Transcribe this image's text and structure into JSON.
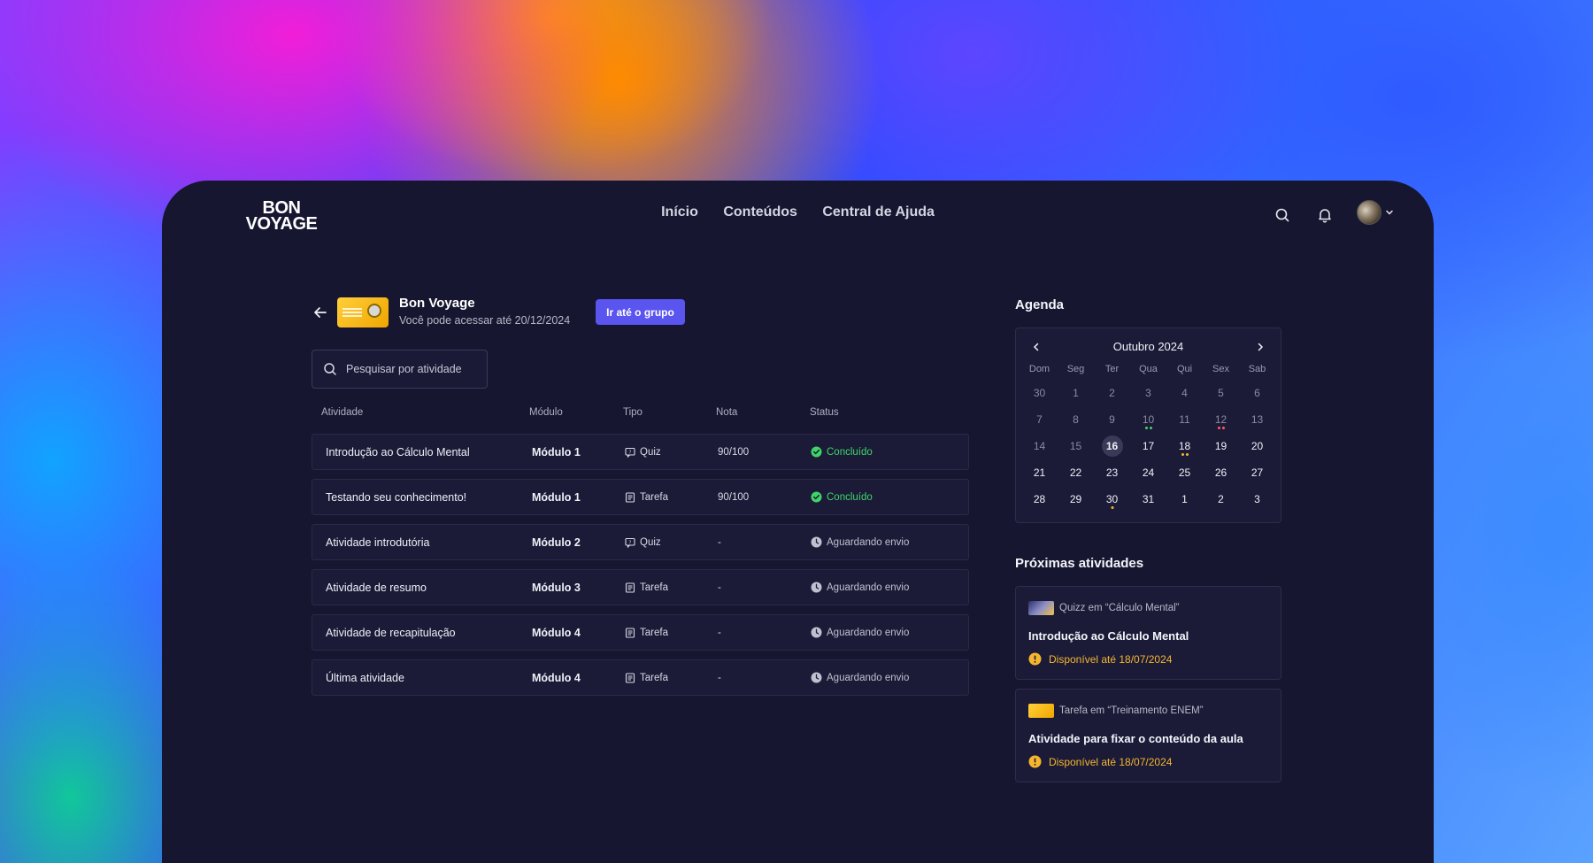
{
  "brand": {
    "logo_line1": "BON",
    "logo_line2": "VOYAGE"
  },
  "nav": {
    "items": [
      "Início",
      "Conteúdos",
      "Central de Ajuda"
    ]
  },
  "course": {
    "title": "Bon Voyage",
    "access": "Você pode acessar até 20/12/2024",
    "group_button": "Ir até o grupo"
  },
  "search": {
    "placeholder": "Pesquisar por atividade"
  },
  "table": {
    "headers": [
      "Atividade",
      "Módulo",
      "Tipo",
      "Nota",
      "Status"
    ],
    "rows": [
      {
        "activity": "Introdução ao Cálculo Mental",
        "module": "Módulo 1",
        "type": "Quiz",
        "type_icon": "quiz-icon",
        "grade": "90/100",
        "status": "Concluído",
        "status_kind": "done"
      },
      {
        "activity": "Testando seu conhecimento!",
        "module": "Módulo 1",
        "type": "Tarefa",
        "type_icon": "task-icon",
        "grade": "90/100",
        "status": "Concluído",
        "status_kind": "done"
      },
      {
        "activity": "Atividade introdutória",
        "module": "Módulo 2",
        "type": "Quiz",
        "type_icon": "quiz-icon",
        "grade": "-",
        "status": "Aguardando envio",
        "status_kind": "waiting"
      },
      {
        "activity": "Atividade de resumo",
        "module": "Módulo 3",
        "type": "Tarefa",
        "type_icon": "task-icon",
        "grade": "-",
        "status": "Aguardando envio",
        "status_kind": "waiting"
      },
      {
        "activity": "Atividade de recapitulação",
        "module": "Módulo 4",
        "type": "Tarefa",
        "type_icon": "task-icon",
        "grade": "-",
        "status": "Aguardando envio",
        "status_kind": "waiting"
      },
      {
        "activity": "Última atividade",
        "module": "Módulo 4",
        "type": "Tarefa",
        "type_icon": "task-icon",
        "grade": "-",
        "status": "Aguardando envio",
        "status_kind": "waiting"
      }
    ]
  },
  "agenda": {
    "title": "Agenda",
    "month": "Outubro 2024",
    "weekdays": [
      "Dom",
      "Seg",
      "Ter",
      "Qua",
      "Qui",
      "Sex",
      "Sab"
    ],
    "days": [
      {
        "d": "30",
        "m": true
      },
      {
        "d": "1",
        "m": true
      },
      {
        "d": "2",
        "m": true
      },
      {
        "d": "3",
        "m": true
      },
      {
        "d": "4",
        "m": true
      },
      {
        "d": "5",
        "m": true
      },
      {
        "d": "6",
        "m": true
      },
      {
        "d": "7",
        "m": true
      },
      {
        "d": "8",
        "m": true
      },
      {
        "d": "9",
        "m": true
      },
      {
        "d": "10",
        "m": true,
        "dots": [
          "#3fd468",
          "#3fd468"
        ]
      },
      {
        "d": "11",
        "m": true
      },
      {
        "d": "12",
        "m": true,
        "dots": [
          "#ff5a5a",
          "#ff5a5a"
        ]
      },
      {
        "d": "13",
        "m": true
      },
      {
        "d": "14",
        "m": true
      },
      {
        "d": "15",
        "m": true
      },
      {
        "d": "16",
        "today": true
      },
      {
        "d": "17"
      },
      {
        "d": "18",
        "dots": [
          "#f5b52e",
          "#f5b52e"
        ]
      },
      {
        "d": "19"
      },
      {
        "d": "20"
      },
      {
        "d": "21"
      },
      {
        "d": "22"
      },
      {
        "d": "23"
      },
      {
        "d": "24"
      },
      {
        "d": "25"
      },
      {
        "d": "26"
      },
      {
        "d": "27"
      },
      {
        "d": "28"
      },
      {
        "d": "29"
      },
      {
        "d": "30",
        "dots": [
          "#f5b52e"
        ]
      },
      {
        "d": "31"
      },
      {
        "d": "1"
      },
      {
        "d": "2"
      },
      {
        "d": "3"
      }
    ]
  },
  "upcoming": {
    "title": "Próximas atividades",
    "items": [
      {
        "meta": "Quizz em “Cálculo Mental”",
        "title": "Introdução ao Cálculo Mental",
        "available": "Disponível até 18/07/2024",
        "thumb": "mental-thumb"
      },
      {
        "meta": "Tarefa em “Treinamento ENEM”",
        "title": "Atividade para fixar o conteúdo da aula",
        "available": "Disponível até 18/07/2024",
        "thumb": "enem-thumb"
      }
    ]
  },
  "colors": {
    "accent": "#5b55f0",
    "success": "#3fd468",
    "warning": "#f5b52e",
    "panel": "#161630"
  }
}
